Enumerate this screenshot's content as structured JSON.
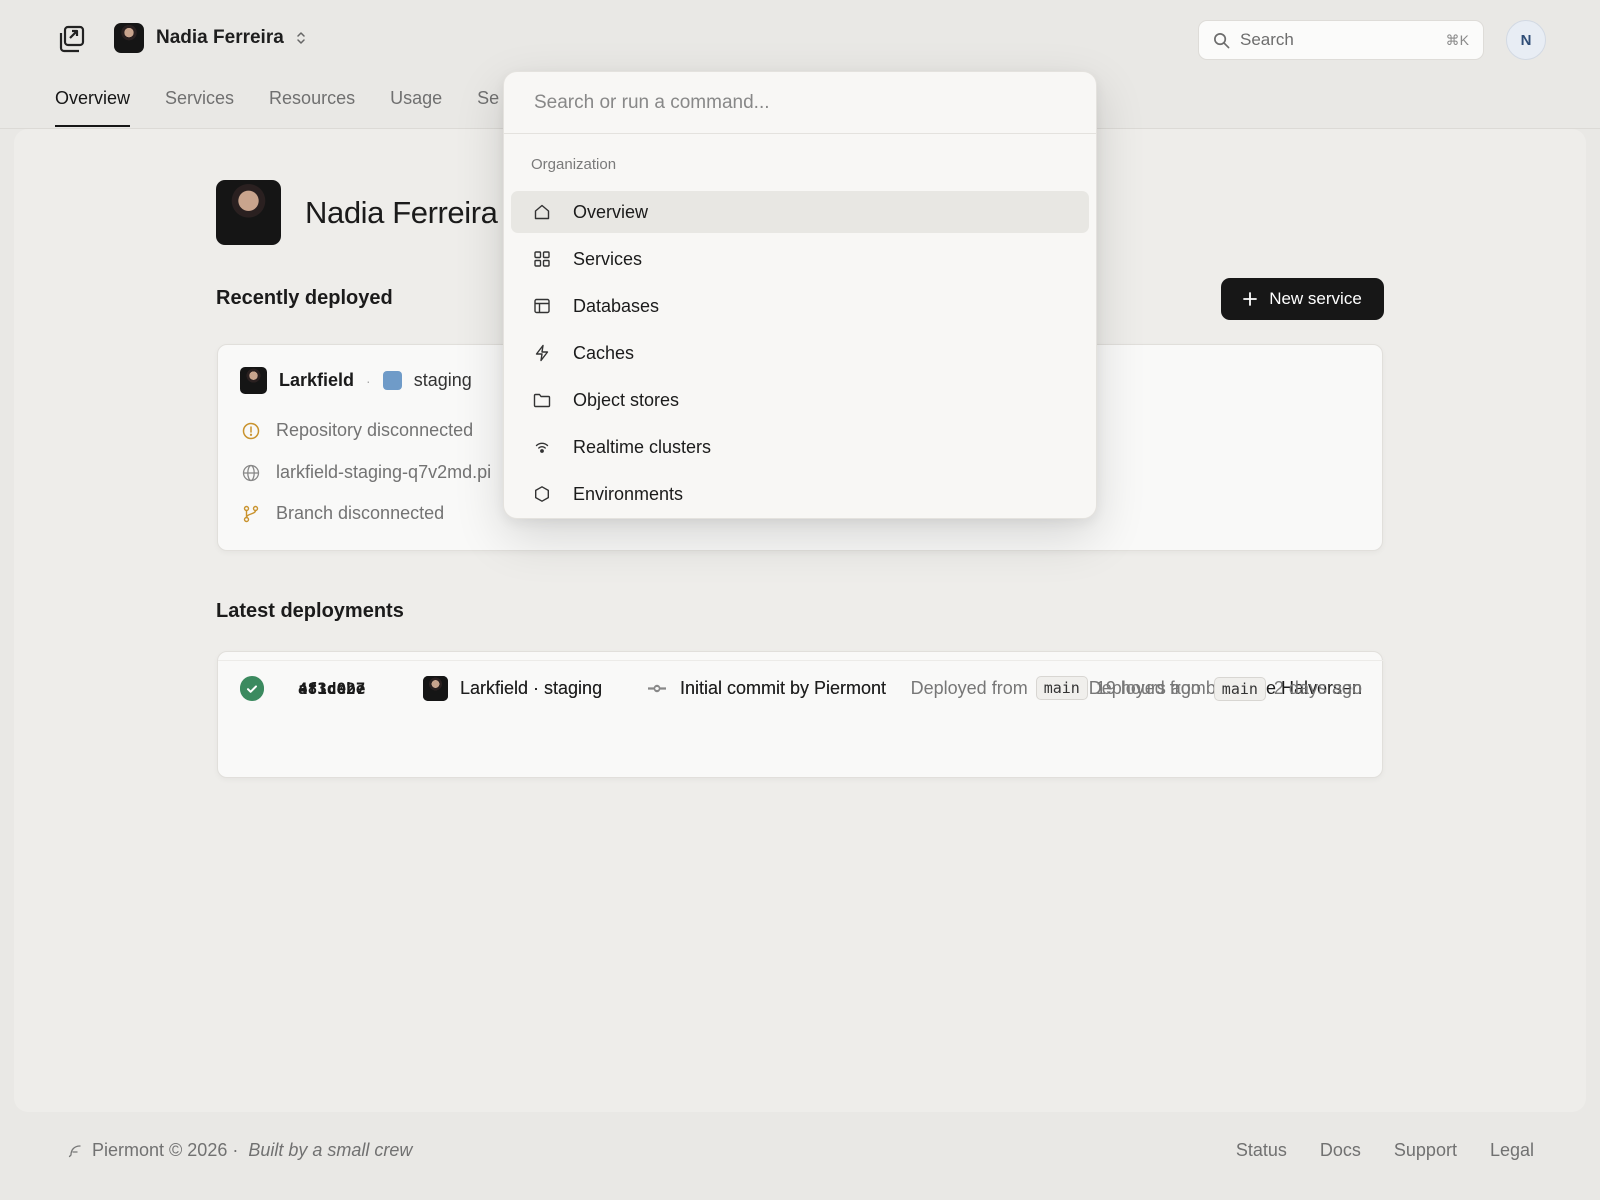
{
  "header": {
    "org_name": "Nadia Ferreira",
    "search_placeholder": "Search",
    "search_shortcut": "⌘K",
    "user_initial": "N"
  },
  "tabs": [
    {
      "label": "Overview",
      "active": true
    },
    {
      "label": "Services"
    },
    {
      "label": "Resources"
    },
    {
      "label": "Usage"
    },
    {
      "label": "Se"
    }
  ],
  "profile": {
    "name": "Nadia Ferreira"
  },
  "recent": {
    "title": "Recently deployed",
    "new_service_label": "New service",
    "service": {
      "name": "Larkfield",
      "environment": "staging",
      "env_color": "#6f9bc8",
      "repo_status": "Repository disconnected",
      "url": "larkfield-staging-q7v2md.pi",
      "branch_status": "Branch disconnected"
    }
  },
  "deployments": {
    "title": "Latest deployments",
    "rows": [
      {
        "sha": "4f1c0be",
        "service": "Larkfield · staging",
        "commit": "Initial commit by Piermont",
        "deployed_from": "Deployed from",
        "branch": "main",
        "when": "19 hours ago by",
        "author": "Rune Halvorsen"
      },
      {
        "sha": "a83de27",
        "service": "Larkfield · staging",
        "commit": "Initial commit by Piermont",
        "deployed_from": "Deployed from",
        "branch": "main",
        "when": "2 days ago",
        "author": ""
      }
    ]
  },
  "palette": {
    "placeholder": "Search or run a command...",
    "group": "Organization",
    "items": [
      {
        "label": "Overview",
        "icon": "home-icon",
        "selected": true
      },
      {
        "label": "Services",
        "icon": "grid-icon"
      },
      {
        "label": "Databases",
        "icon": "table-icon"
      },
      {
        "label": "Caches",
        "icon": "bolt-icon"
      },
      {
        "label": "Object stores",
        "icon": "folder-icon"
      },
      {
        "label": "Realtime clusters",
        "icon": "broadcast-icon"
      },
      {
        "label": "Environments",
        "icon": "hexagon-icon"
      }
    ]
  },
  "footer": {
    "copyright": "Piermont © 2026 ·",
    "tagline": "Built by a small crew",
    "links": [
      "Status",
      "Docs",
      "Support",
      "Legal"
    ]
  },
  "colors": {
    "accent": "#171717",
    "success": "#3b8a5f",
    "warning": "#c9932e",
    "background": "#e9e8e5"
  }
}
